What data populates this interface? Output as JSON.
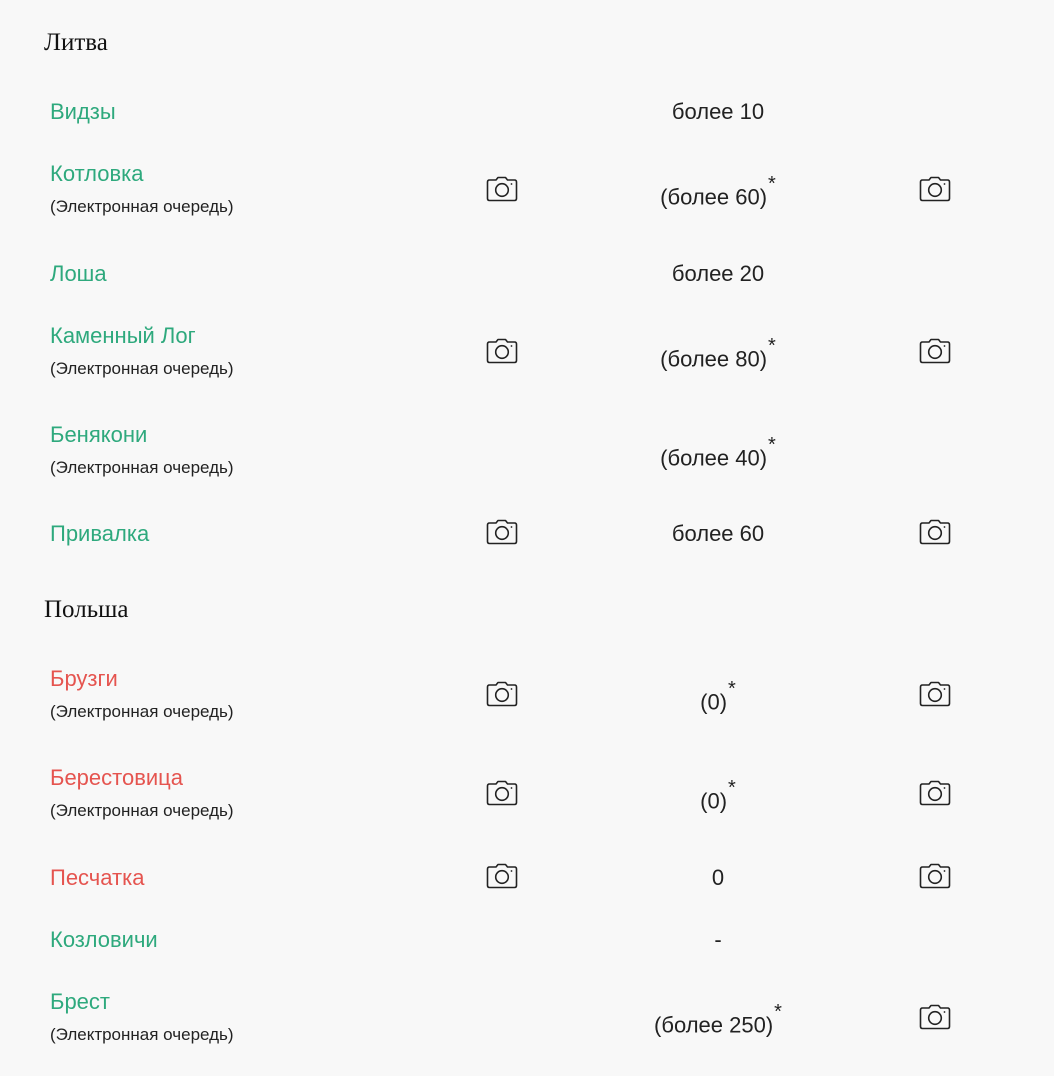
{
  "sections": [
    {
      "country": "Литва",
      "rows": [
        {
          "name": "Видзы",
          "status": "green",
          "sub": "",
          "count": "более 10",
          "star": "",
          "cam_left": false,
          "cam_right": false
        },
        {
          "name": "Котловка",
          "status": "green",
          "sub": "(Электронная очередь)",
          "count": "(более 60)",
          "star": "*",
          "cam_left": true,
          "cam_right": true
        },
        {
          "name": "Лоша",
          "status": "green",
          "sub": "",
          "count": "более 20",
          "star": "",
          "cam_left": false,
          "cam_right": false
        },
        {
          "name": "Каменный Лог",
          "status": "green",
          "sub": "(Электронная очередь)",
          "count": "(более 80)",
          "star": "*",
          "cam_left": true,
          "cam_right": true
        },
        {
          "name": "Бенякони",
          "status": "green",
          "sub": "(Электронная очередь)",
          "count": "(более 40)",
          "star": "*",
          "cam_left": false,
          "cam_right": false
        },
        {
          "name": "Привалка",
          "status": "green",
          "sub": "",
          "count": "более 60",
          "star": "",
          "cam_left": true,
          "cam_right": true
        }
      ]
    },
    {
      "country": "Польша",
      "rows": [
        {
          "name": "Брузги",
          "status": "red",
          "sub": "(Электронная очередь)",
          "count": "(0)",
          "star": "*",
          "cam_left": true,
          "cam_right": true
        },
        {
          "name": "Берестовица",
          "status": "red",
          "sub": "(Электронная очередь)",
          "count": "(0)",
          "star": "*",
          "cam_left": true,
          "cam_right": true
        },
        {
          "name": "Песчатка",
          "status": "red",
          "sub": "",
          "count": "0",
          "star": "",
          "cam_left": true,
          "cam_right": true
        },
        {
          "name": "Козловичи",
          "status": "green",
          "sub": "",
          "count": "-",
          "star": "",
          "cam_left": false,
          "cam_right": false
        },
        {
          "name": "Брест",
          "status": "green",
          "sub": "(Электронная очередь)",
          "count": "(более 250)",
          "star": "*",
          "cam_left": false,
          "cam_right": true
        }
      ]
    }
  ],
  "colors": {
    "status_green": "#2ea97d",
    "status_red": "#e5544f",
    "background": "#f8f8f8"
  },
  "icons": {
    "camera": "camera-icon"
  }
}
